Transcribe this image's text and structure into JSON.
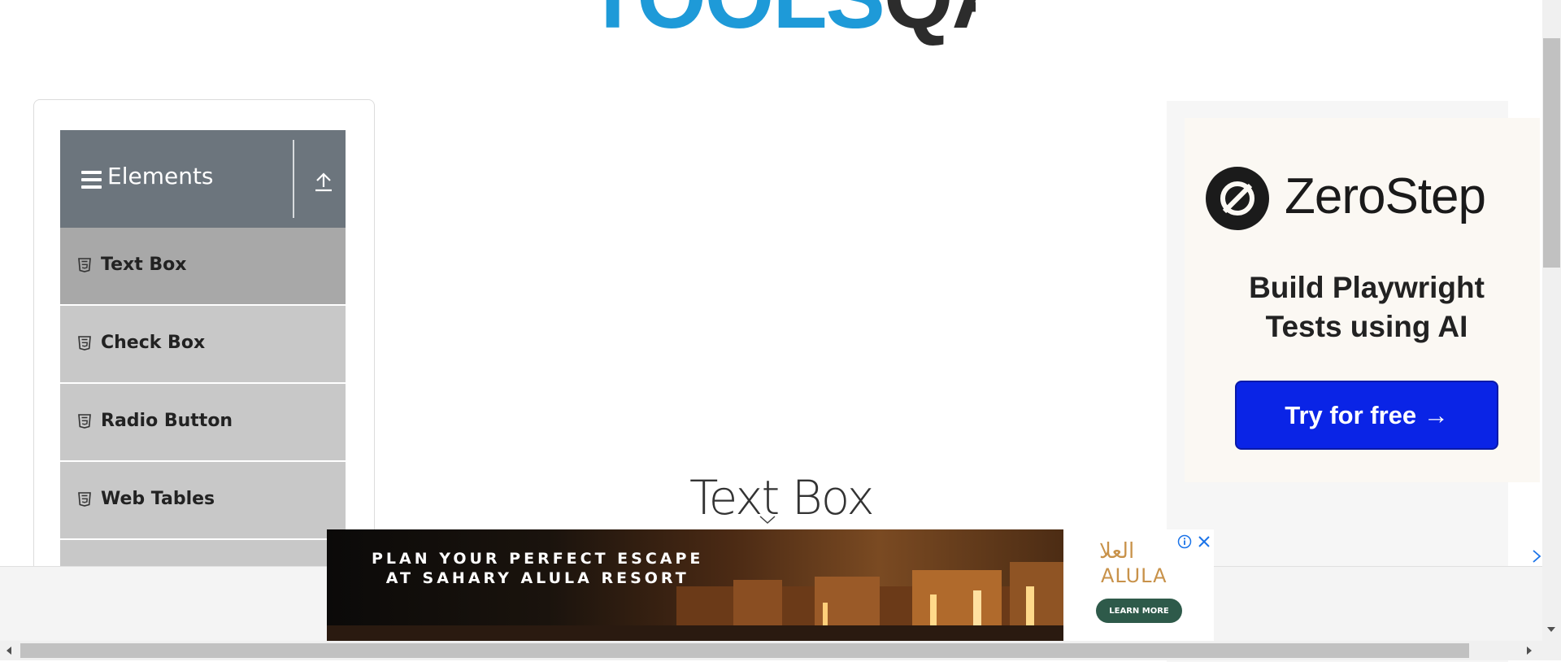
{
  "logo": {
    "part1": "TOOLS",
    "part2": "QA"
  },
  "sidebar": {
    "group_title": "Elements",
    "items": [
      {
        "label": "Text Box",
        "active": true
      },
      {
        "label": "Check Box",
        "active": false
      },
      {
        "label": "Radio Button",
        "active": false
      },
      {
        "label": "Web Tables",
        "active": false
      }
    ]
  },
  "main": {
    "page_title": "Text Box"
  },
  "ad_right": {
    "brand": "ZeroStep",
    "tagline_line1": "Build Playwright",
    "tagline_line2": "Tests using AI",
    "cta": "Try for free →"
  },
  "ad_bottom": {
    "headline_line1": "PLAN YOUR PERFECT ESCAPE",
    "headline_line2": "AT SAHARY ALULA RESORT",
    "brand_arabic": "العلا",
    "brand_latin": "ALULA",
    "cta": "LEARN MORE"
  },
  "icons": {
    "menu": "hamburger-icon",
    "collapse": "arrow-up-icon",
    "item": "html5-icon",
    "ad_info": "info-icon",
    "ad_close": "close-icon"
  },
  "colors": {
    "group_header": "#6c757d",
    "item_bg": "#c8c8c8",
    "item_active_bg": "#a8a8a8",
    "cta_blue": "#0a24e6",
    "logo_blue": "#1e9ad8"
  }
}
